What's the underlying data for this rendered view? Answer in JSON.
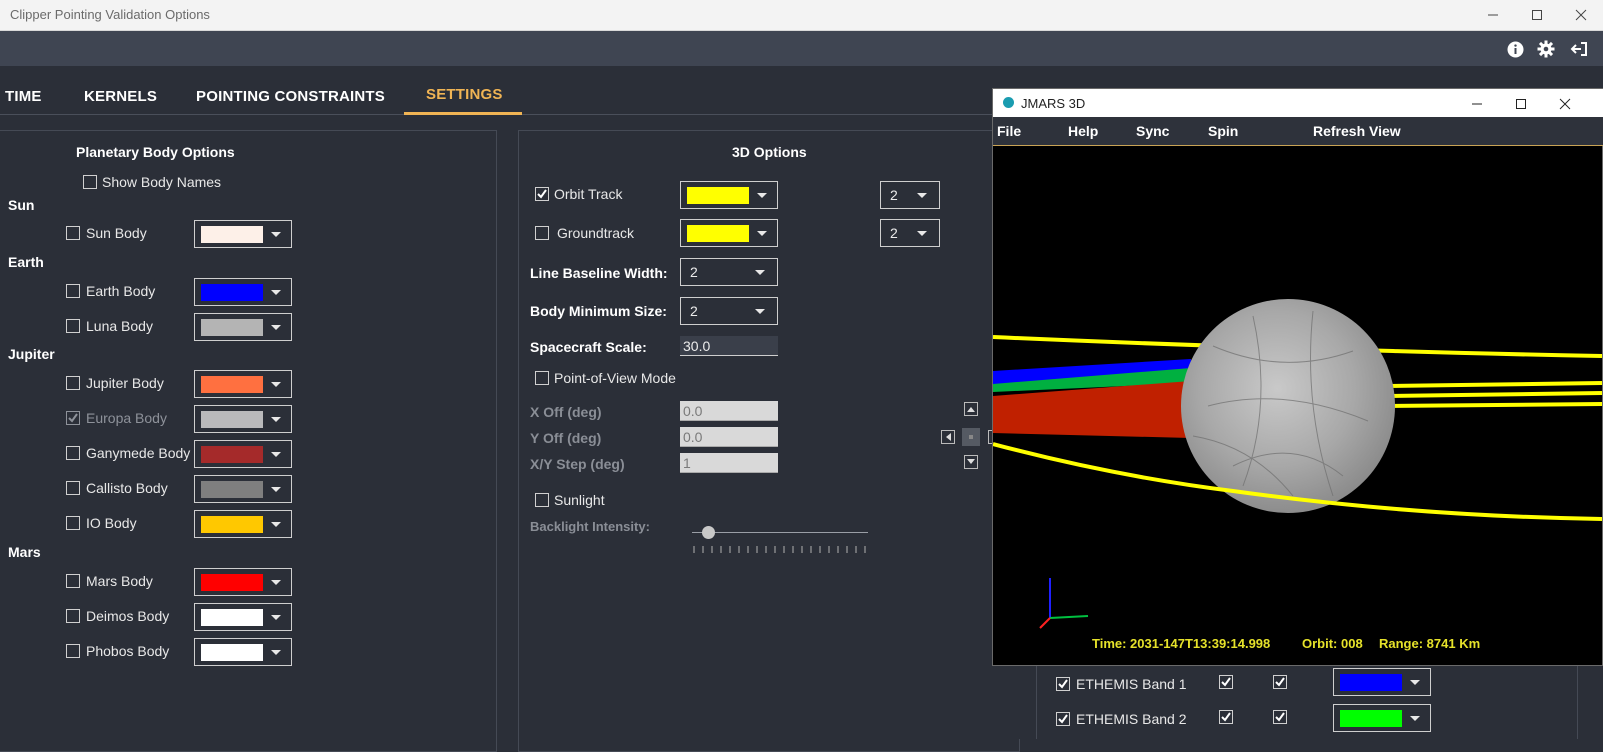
{
  "window": {
    "title": "Clipper Pointing Validation Options"
  },
  "tabs": [
    {
      "label": "TIME",
      "active": false
    },
    {
      "label": "KERNELS",
      "active": false
    },
    {
      "label": "POINTING CONSTRAINTS",
      "active": false
    },
    {
      "label": "SETTINGS",
      "active": true
    }
  ],
  "planetary": {
    "header": "Planetary Body Options",
    "show_names": {
      "label": "Show Body Names",
      "checked": false
    },
    "groups": [
      {
        "name": "Sun",
        "bodies": [
          {
            "label": "Sun Body",
            "checked": false,
            "color": "#fdf0e8"
          }
        ]
      },
      {
        "name": "Earth",
        "bodies": [
          {
            "label": "Earth Body",
            "checked": false,
            "color": "#0000ff"
          },
          {
            "label": "Luna Body",
            "checked": false,
            "color": "#b4b4b4"
          }
        ]
      },
      {
        "name": "Jupiter",
        "bodies": [
          {
            "label": "Jupiter Body",
            "checked": false,
            "color": "#ff7040"
          },
          {
            "label": "Europa Body",
            "checked": true,
            "disabled": true,
            "color": "#b9b9bb"
          },
          {
            "label": "Ganymede Body",
            "checked": false,
            "color": "#a52a2a"
          },
          {
            "label": "Callisto Body",
            "checked": false,
            "color": "#7f7f7f"
          },
          {
            "label": "IO Body",
            "checked": false,
            "color": "#ffc800"
          }
        ]
      },
      {
        "name": "Mars",
        "bodies": [
          {
            "label": "Mars Body",
            "checked": false,
            "color": "#ff0000"
          },
          {
            "label": "Deimos Body",
            "checked": false,
            "color": "#ffffff"
          },
          {
            "label": "Phobos Body",
            "checked": false,
            "color": "#ffffff"
          }
        ]
      }
    ]
  },
  "options3d": {
    "header": "3D Options",
    "orbit_track": {
      "label": "Orbit Track",
      "checked": true,
      "color": "#ffff00",
      "width": "2"
    },
    "groundtrack": {
      "label": "Groundtrack",
      "checked": false,
      "color": "#ffff00",
      "width": "2"
    },
    "line_baseline": {
      "label": "Line Baseline Width:",
      "value": "2"
    },
    "body_min": {
      "label": "Body Minimum Size:",
      "value": "2"
    },
    "spacecraft_scale": {
      "label": "Spacecraft Scale:",
      "value": "30.0"
    },
    "pov_mode": {
      "label": "Point-of-View Mode",
      "checked": false
    },
    "x_off": {
      "label": "X Off (deg)",
      "value": "0.0"
    },
    "y_off": {
      "label": "Y Off (deg)",
      "value": "0.0"
    },
    "xy_step": {
      "label": "X/Y Step (deg)",
      "value": "1"
    },
    "sunlight": {
      "label": "Sunlight",
      "checked": false
    },
    "backlight": {
      "label": "Backlight Intensity:",
      "value": 0.1
    }
  },
  "jmars": {
    "title": "JMARS 3D",
    "menu": [
      "File",
      "Help",
      "Sync",
      "Spin",
      "Refresh View"
    ],
    "time": "Time: 2031-147T13:39:14.998",
    "orbit": "Orbit: 008",
    "range": "Range: 8741 Km"
  },
  "bands": [
    {
      "label": "ETHEMIS Band 1",
      "checked": true,
      "c1": true,
      "c2": true,
      "color": "#0000ff"
    },
    {
      "label": "ETHEMIS Band 2",
      "checked": true,
      "c1": true,
      "c2": true,
      "color": "#00ff00"
    }
  ],
  "colors": {
    "accent": "#f0b454",
    "status": "#e6e22a"
  },
  "icons": [
    "info-icon",
    "gear-icon",
    "logout-icon",
    "minimize-icon",
    "maximize-icon",
    "close-icon",
    "jmars-logo-icon"
  ]
}
